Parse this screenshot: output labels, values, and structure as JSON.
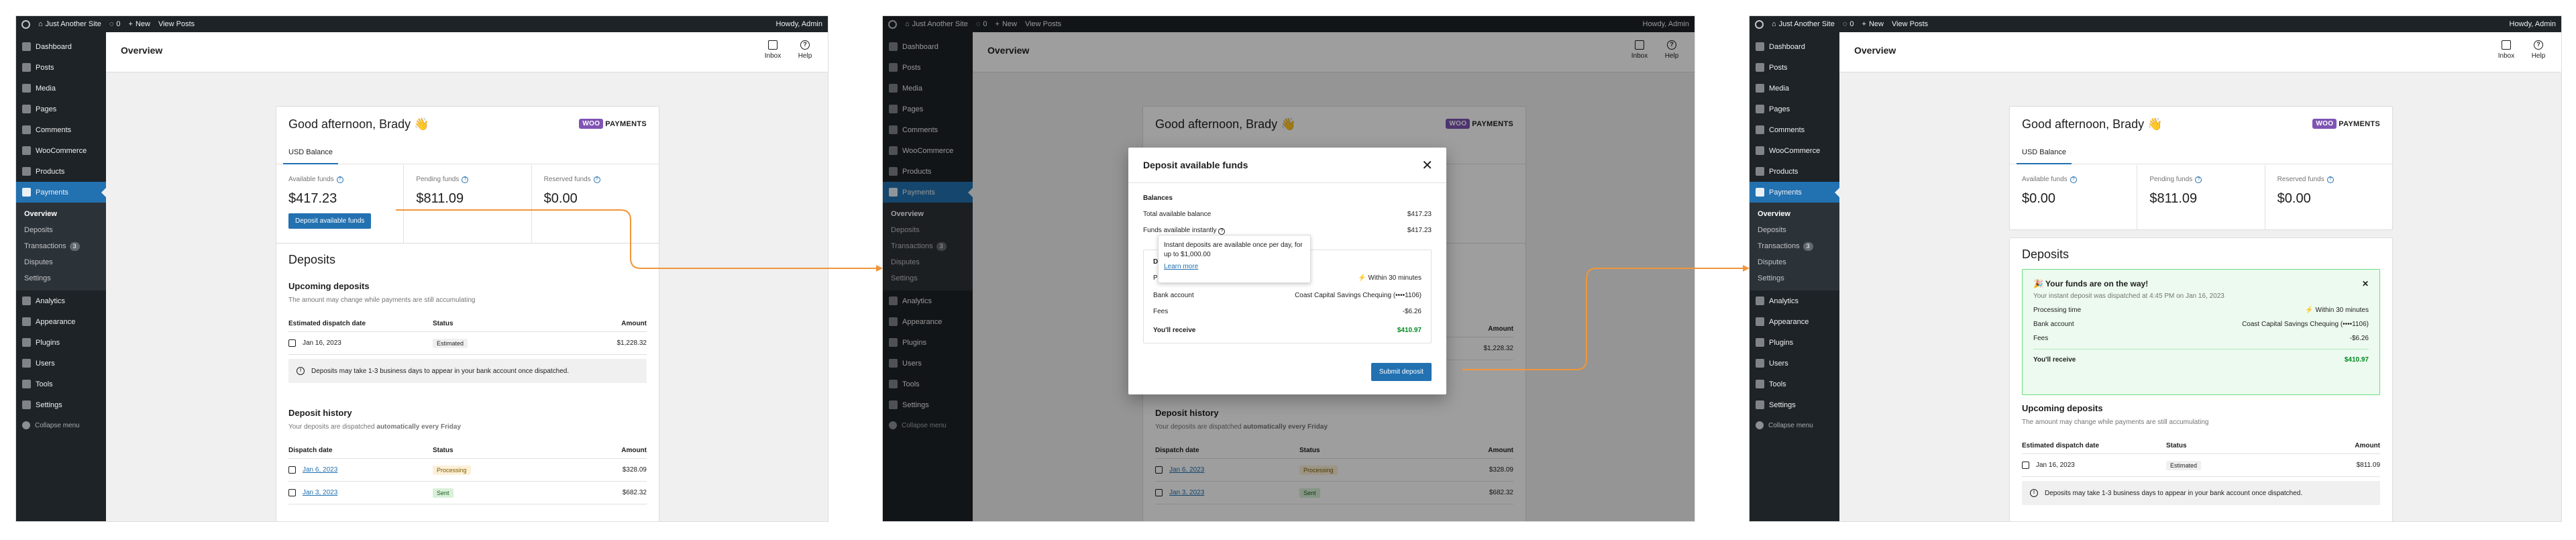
{
  "colors": {
    "accent": "#2271b1",
    "arrow": "#f0963a",
    "sidebar": "#1d2327",
    "success": "#008a20"
  },
  "adminbar": {
    "site": "Just Another Site",
    "comments": "0",
    "new": "New",
    "view_posts": "View Posts",
    "howdy": "Howdy, Admin"
  },
  "sidebar": {
    "items_top": [
      "Dashboard",
      "Posts",
      "Media",
      "Pages",
      "Comments",
      "WooCommerce",
      "Products"
    ],
    "active": "Payments",
    "submenu": [
      "Overview",
      "Deposits",
      "Transactions",
      "Disputes",
      "Settings"
    ],
    "transactions_badge": "3",
    "items_bottom": [
      "Analytics",
      "Appearance",
      "Plugins",
      "Users",
      "Tools",
      "Settings"
    ],
    "collapse": "Collapse menu"
  },
  "header": {
    "title": "Overview",
    "inbox": "Inbox",
    "help": "Help",
    "help_glyph": "?"
  },
  "overview": {
    "greeting": "Good afternoon, Brady 👋",
    "logo_woo": "WOO",
    "logo_payments": "PAYMENTS",
    "tab": "USD Balance",
    "available_label": "Available funds",
    "pending_label": "Pending funds",
    "reserved_label": "Reserved funds",
    "available_before": "$417.23",
    "available_after": "$0.00",
    "pending": "$811.09",
    "reserved": "$0.00",
    "deposit_button": "Deposit available funds",
    "q": "?"
  },
  "deposits": {
    "title": "Deposits",
    "upcoming_title": "Upcoming deposits",
    "upcoming_sub": "The amount may change while payments are still accumulating",
    "col_est_date": "Estimated dispatch date",
    "col_status": "Status",
    "col_amount": "Amount",
    "upcoming_date": "Jan 16, 2023",
    "upcoming_status": "Estimated",
    "upcoming_amount_before": "$1,228.32",
    "upcoming_amount_after": "$811.09",
    "note": "Deposits may take 1-3 business days to appear in your bank account once dispatched.",
    "info_glyph": "!",
    "history_title": "Deposit history",
    "history_sub_prefix": "Your deposits are dispatched ",
    "history_sub_bold": "automatically every Friday",
    "col_dispatch_date": "Dispatch date",
    "history": [
      {
        "date": "Jan 6, 2023",
        "status": "Processing",
        "amount": "$328.09"
      },
      {
        "date": "Jan 3, 2023",
        "status": "Sent",
        "amount": "$682.32"
      }
    ]
  },
  "modal": {
    "title": "Deposit available funds",
    "close": "✕",
    "balances": "Balances",
    "total_label": "Total available balance",
    "total_value": "$417.23",
    "instant_label": "Funds available instantly",
    "instant_value": "$417.23",
    "deposit_heading": "De",
    "processing_prefix": "Pr",
    "processing_value": "Within 30 minutes",
    "bank_label": "Bank account",
    "bank_value": "Coast Capital Savings Chequing (••••1106)",
    "fees_label": "Fees",
    "fees_value": "-$6.26",
    "receive_label": "You'll receive",
    "receive_value": "$410.97",
    "tooltip": "Instant deposits are available once per day, for up to $1,000.00",
    "tooltip_link": "Learn more",
    "submit": "Submit deposit"
  },
  "success": {
    "title": "🎉 Your funds are on the way!",
    "sub": "Your instant deposit was dispatched at 4:45 PM on Jan 16, 2023",
    "close": "✕",
    "time_label": "Processing time",
    "time_value": "Within 30 minutes",
    "bank_label": "Bank account",
    "bank_value": "Coast Capital Savings Chequing (••••1106)",
    "fees_label": "Fees",
    "fees_value": "-$6.26",
    "receive_label": "You'll receive",
    "receive_value": "$410.97"
  }
}
